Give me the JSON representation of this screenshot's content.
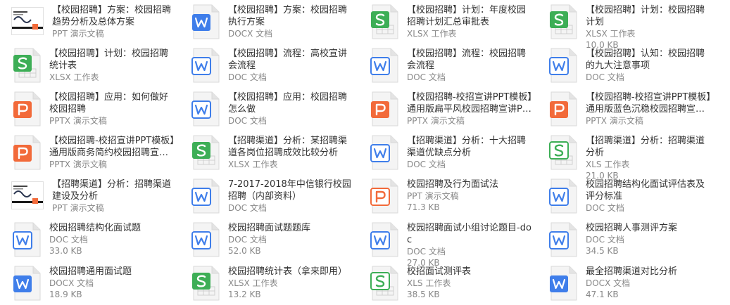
{
  "colors": {
    "ppt": "#F26A3A",
    "doc": "#3F7EEA",
    "xls": "#3DAE56",
    "xls_light": "#6FC07F",
    "fold": "#e4e4e4",
    "paper": "#f4f4f4"
  },
  "files": [
    {
      "title": "【校园招聘】方案：校园招聘趋势分析及总体方案",
      "type": "PPT 演示文稿",
      "size": "",
      "icon": "presentation-thumbnail-icon"
    },
    {
      "title": "【校园招聘】方案：校园招聘执行方案",
      "type": "DOCX 文档",
      "size": "",
      "icon": "doc-icon"
    },
    {
      "title": "【校园招聘】计划：年度校园招聘计划汇总审批表",
      "type": "XLSX 工作表",
      "size": "",
      "icon": "xls-icon"
    },
    {
      "title": "【校园招聘】计划：校园招聘计划",
      "type": "XLSX 工作表",
      "size": "10.0 KB",
      "icon": "xls-icon"
    },
    {
      "title": "【校园招聘】计划：校园招聘统计表",
      "type": "XLSX 工作表",
      "size": "",
      "icon": "xls-icon"
    },
    {
      "title": "【校园招聘】流程：高校宣讲会流程",
      "type": "DOC 文档",
      "size": "",
      "icon": "doc-outline-icon"
    },
    {
      "title": "【校园招聘】流程：校园招聘会流程",
      "type": "DOC 文档",
      "size": "",
      "icon": "doc-outline-icon"
    },
    {
      "title": "【校园招聘】认知：校园招聘的九大注意事项",
      "type": "DOC 文档",
      "size": "",
      "icon": "doc-outline-icon"
    },
    {
      "title": "【校园招聘】应用：如何做好校园招聘",
      "type": "PPTX 演示文稿",
      "size": "",
      "icon": "ppt-icon"
    },
    {
      "title": "【校园招聘】应用：校园招聘怎么做",
      "type": "DOC 文档",
      "size": "",
      "icon": "doc-outline-icon"
    },
    {
      "title": "【校园招聘-校招宣讲PPT模板】通用版扁平风校园招聘宣讲PPT-pptx",
      "type": "PPTX 演示文稿",
      "size": "",
      "icon": "ppt-icon"
    },
    {
      "title": "【校园招聘-校招宣讲PPT模板】通用版蓝色沉稳校园招聘宣讲PPT-p...",
      "type": "PPTX 演示文稿",
      "size": "",
      "icon": "ppt-icon"
    },
    {
      "title": "【校园招聘-校招宣讲PPT模板】通用版商务简约校园招聘宣讲PPT-p...",
      "type": "PPTX 演示文稿",
      "size": "",
      "icon": "ppt-icon"
    },
    {
      "title": "【招聘渠道】分析：某招聘渠道各岗位招聘成效比较分析",
      "type": "XLSX 工作表",
      "size": "",
      "icon": "xls-icon"
    },
    {
      "title": "【招聘渠道】分析：十大招聘渠道优缺点分析",
      "type": "DOC 文档",
      "size": "",
      "icon": "doc-outline-icon"
    },
    {
      "title": "【招聘渠道】分析：招聘渠道分析",
      "type": "XLS 工作表",
      "size": "21.0 KB",
      "icon": "xls-outline-icon"
    },
    {
      "title": "【招聘渠道】分析：招聘渠道建设及分析",
      "type": "PPT 演示文稿",
      "size": "",
      "icon": "presentation-thumbnail-icon"
    },
    {
      "title": "7-2017-2018年中信银行校园招聘（内部资料）",
      "type": "DOC 文档",
      "size": "",
      "icon": "doc-outline-icon"
    },
    {
      "title": "校园招聘及行为面试法",
      "type": "PPT 演示文稿",
      "size": "71.3 KB",
      "icon": "ppt-outline-icon"
    },
    {
      "title": "校园招聘结构化面试评估表及评分标准",
      "type": "DOC 文档",
      "size": "",
      "icon": "doc-outline-icon"
    },
    {
      "title": "校园招聘结构化面试题",
      "type": "DOC 文档",
      "size": "33.0 KB",
      "icon": "doc-outline-icon"
    },
    {
      "title": "校园招聘面试题题库",
      "type": "DOC 文档",
      "size": "52.0 KB",
      "icon": "doc-outline-icon"
    },
    {
      "title": "校园招聘面试小组讨论题目-doc",
      "type": "DOC 文档",
      "size": "27.0 KB",
      "icon": "doc-outline-icon"
    },
    {
      "title": "校园招聘人事测评方案",
      "type": "DOC 文档",
      "size": "34.5 KB",
      "icon": "doc-outline-icon"
    },
    {
      "title": "校园招聘通用面试题",
      "type": "DOCX 文档",
      "size": "18.9 KB",
      "icon": "doc-icon"
    },
    {
      "title": "校园招聘统计表（拿来即用）",
      "type": "XLSX 工作表",
      "size": "13.2 KB",
      "icon": "xls-icon"
    },
    {
      "title": "校招面试测评表",
      "type": "XLS 工作表",
      "size": "38.5 KB",
      "icon": "xls-outline-icon"
    },
    {
      "title": "最全招聘渠道对比分析",
      "type": "DOCX 文档",
      "size": "47.1 KB",
      "icon": "doc-icon"
    }
  ]
}
